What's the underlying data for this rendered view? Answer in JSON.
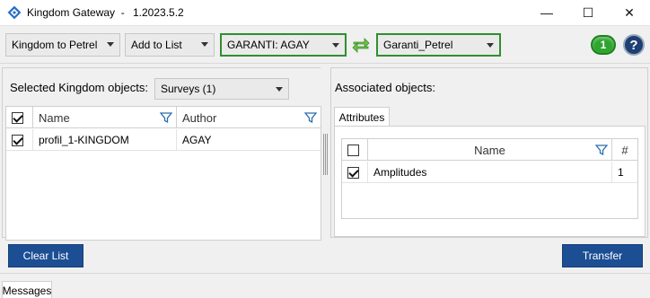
{
  "window": {
    "title": "Kingdom Gateway  -",
    "version": "1.2023.5.2",
    "minimize_glyph": "—",
    "maximize_glyph": "☐",
    "close_glyph": "✕"
  },
  "toolbar": {
    "mode_value": "Kingdom to  Petrel",
    "action_value": "Add to List",
    "source_value": "GARANTI: AGAY",
    "destination_value": "Garanti_Petrel",
    "status_badge": "1",
    "help_label": "?"
  },
  "left_panel": {
    "label": "Selected Kingdom objects:",
    "filter_value": "Surveys (1)",
    "columns": [
      "Name",
      "Author"
    ],
    "rows": [
      {
        "checked": true,
        "name": "profil_1-KINGDOM",
        "author": "AGAY"
      }
    ]
  },
  "right_panel": {
    "label": "Associated objects:",
    "tab": "Attributes",
    "columns": [
      "Name",
      "#"
    ],
    "rows": [
      {
        "checked": true,
        "name": "Amplitudes",
        "count": "1"
      }
    ]
  },
  "buttons": {
    "clear_label": "Clear List",
    "transfer_label": "Transfer"
  },
  "footer": {
    "messages_tab": "Messages"
  },
  "colors": {
    "accent_green": "#2f8f2f",
    "button_blue": "#1c4e94",
    "help_blue": "#1e3f73"
  }
}
